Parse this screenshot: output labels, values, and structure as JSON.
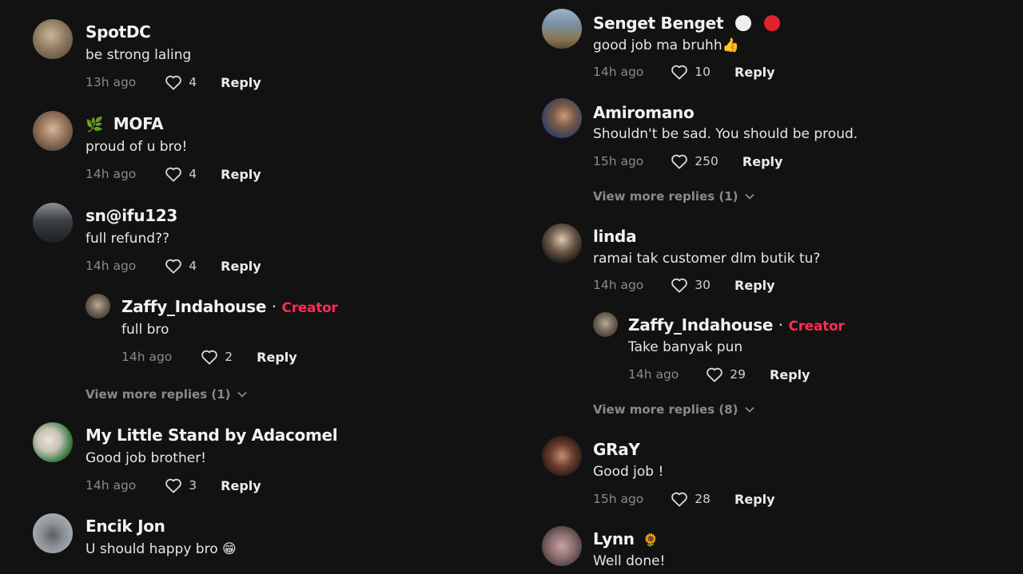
{
  "left": [
    {
      "user": "SpotDC",
      "text": "be strong laling",
      "time": "13h ago",
      "likes": "4",
      "reply": "Reply"
    },
    {
      "user_icon": "🌿",
      "user": "MOFA",
      "text": "proud of u bro!",
      "time": "14h ago",
      "likes": "4",
      "reply": "Reply"
    },
    {
      "user": "sn@ifu123",
      "text": "full refund??",
      "time": "14h ago",
      "likes": "4",
      "reply": "Reply"
    },
    {
      "user": "Zaffy_Indahouse",
      "separator": "·",
      "creator": "Creator",
      "text": "full bro",
      "time": "14h ago",
      "likes": "2",
      "reply": "Reply"
    },
    {
      "more": "View more replies (1)"
    },
    {
      "user": "My Little Stand by Adacomel",
      "text": "Good job brother!",
      "time": "14h ago",
      "likes": "3",
      "reply": "Reply"
    },
    {
      "user": "Encik Jon",
      "text": "U should happy bro 😁"
    }
  ],
  "right": [
    {
      "user": "Senget Benget",
      "text": "good job ma bruhh👍",
      "time": "14h ago",
      "likes": "10",
      "reply": "Reply"
    },
    {
      "user": "Amiromano",
      "text": "Shouldn't be sad. You should be proud.",
      "time": "15h ago",
      "likes": "250",
      "reply": "Reply"
    },
    {
      "more": "View more replies (1)"
    },
    {
      "user": "linda",
      "text": "ramai tak customer dlm butik tu?",
      "time": "14h ago",
      "likes": "30",
      "reply": "Reply"
    },
    {
      "user": "Zaffy_Indahouse",
      "separator": "·",
      "creator": "Creator",
      "text": "Take banyak pun",
      "time": "14h ago",
      "likes": "29",
      "reply": "Reply"
    },
    {
      "more": "View more replies (8)"
    },
    {
      "user": "GRaY",
      "text": "Good job !",
      "time": "15h ago",
      "likes": "28",
      "reply": "Reply"
    },
    {
      "user": "Lynn",
      "user_icon": "🌻",
      "text": "Well done!"
    }
  ],
  "colors": {
    "background": "#121212",
    "creator": "#fe2c55",
    "muted": "#8a8a8a"
  }
}
